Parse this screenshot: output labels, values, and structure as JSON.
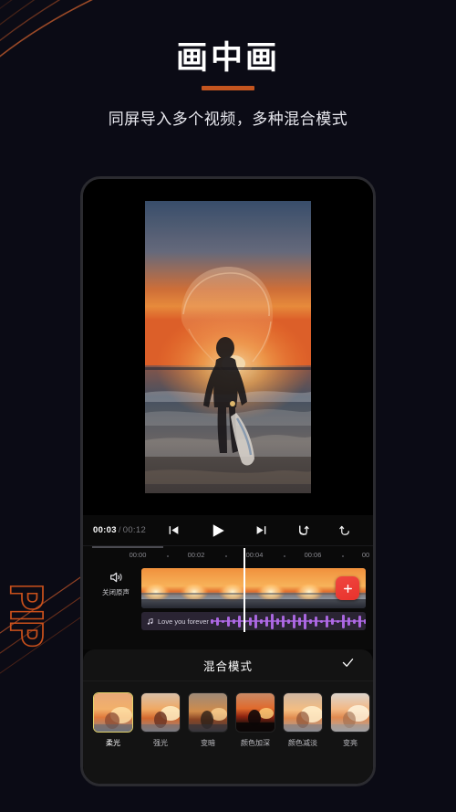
{
  "page": {
    "background_color": "#0b0b15",
    "accent_color": "#c4551f",
    "side_decoration_text": "PIP"
  },
  "header": {
    "title": "画中画",
    "subtitle": "同屏导入多个视频，多种混合模式"
  },
  "editor": {
    "player": {
      "current_time": "00:03",
      "separator": "/",
      "total_time": "00:12",
      "controls": [
        {
          "name": "skip-previous",
          "label": "上一帧"
        },
        {
          "name": "play",
          "label": "播放"
        },
        {
          "name": "skip-next",
          "label": "下一帧"
        },
        {
          "name": "undo",
          "label": "撤销"
        },
        {
          "name": "redo",
          "label": "重做"
        }
      ]
    },
    "timeline": {
      "ruler_ticks": [
        "00:00",
        "00:02",
        "00:04",
        "00:06",
        "00"
      ],
      "mute_button_label": "关闭原声",
      "add_clip_label": "+",
      "audio_clip": {
        "icon": "music-note-icon",
        "title": "Love you forever"
      }
    },
    "blend_panel": {
      "title": "混合模式",
      "confirm_label": "✓",
      "modes": [
        {
          "label": "柔光",
          "selected": true
        },
        {
          "label": "强光",
          "selected": false
        },
        {
          "label": "变暗",
          "selected": false
        },
        {
          "label": "颜色加深",
          "selected": false
        },
        {
          "label": "颜色减淡",
          "selected": false
        },
        {
          "label": "变亮",
          "selected": false
        }
      ]
    }
  }
}
